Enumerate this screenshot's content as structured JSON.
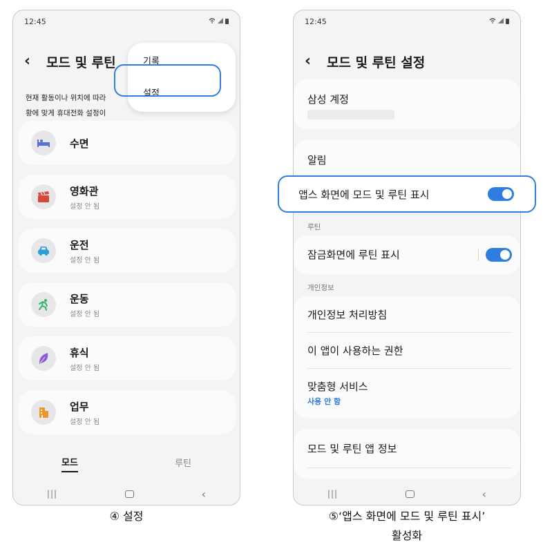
{
  "left_screen": {
    "status_time": "12:45",
    "title": "모드 및 루틴",
    "description_lines": [
      "현재 활동이나 위치에 따라",
      "황에 맞게 휴대전화 설정이"
    ],
    "popup_menu": [
      "기록",
      "설정"
    ],
    "modes": [
      {
        "name": "수면",
        "status": "",
        "icon": "bed-icon",
        "color": "#5a6fd8"
      },
      {
        "name": "영화관",
        "status": "설정 안 됨",
        "icon": "clapperboard-icon",
        "color": "#d9463a"
      },
      {
        "name": "운전",
        "status": "설정 안 됨",
        "icon": "car-icon",
        "color": "#2e9fd6"
      },
      {
        "name": "운동",
        "status": "설정 안 됨",
        "icon": "running-icon",
        "color": "#2fb36a"
      },
      {
        "name": "휴식",
        "status": "설정 안 됨",
        "icon": "leaf-icon",
        "color": "#8e5ad8"
      },
      {
        "name": "업무",
        "status": "설정 안 됨",
        "icon": "building-icon",
        "color": "#f0952a"
      }
    ],
    "tabs": [
      "모드",
      "루틴"
    ],
    "active_tab": "모드",
    "caption": "④ 설정"
  },
  "right_screen": {
    "status_time": "12:45",
    "title": "모드 및 루틴 설정",
    "samsung_account": "삼성 계정",
    "notifications": "알림",
    "show_on_apps_screen": "앱스 화면에 모드 및 루틴 표시",
    "routine_section": "루틴",
    "show_on_lock_screen": "잠금화면에 루틴 표시",
    "privacy_section": "개인정보",
    "privacy_policy": "개인정보 처리방침",
    "app_permissions": "이 앱이 사용하는 권한",
    "custom_service": "맞춤형 서비스",
    "custom_service_status": "사용 안 함",
    "about_app": "모드 및 루틴 앱 정보",
    "toggles": {
      "apps_screen": true,
      "lock_screen": true
    },
    "caption_line1": "⑤‘앱스 화면에 모드 및 루틴 표시’",
    "caption_line2": "활성화"
  },
  "colors": {
    "accent": "#2f7de1",
    "background": "#f4f4f4",
    "card": "#fbfbfb"
  }
}
